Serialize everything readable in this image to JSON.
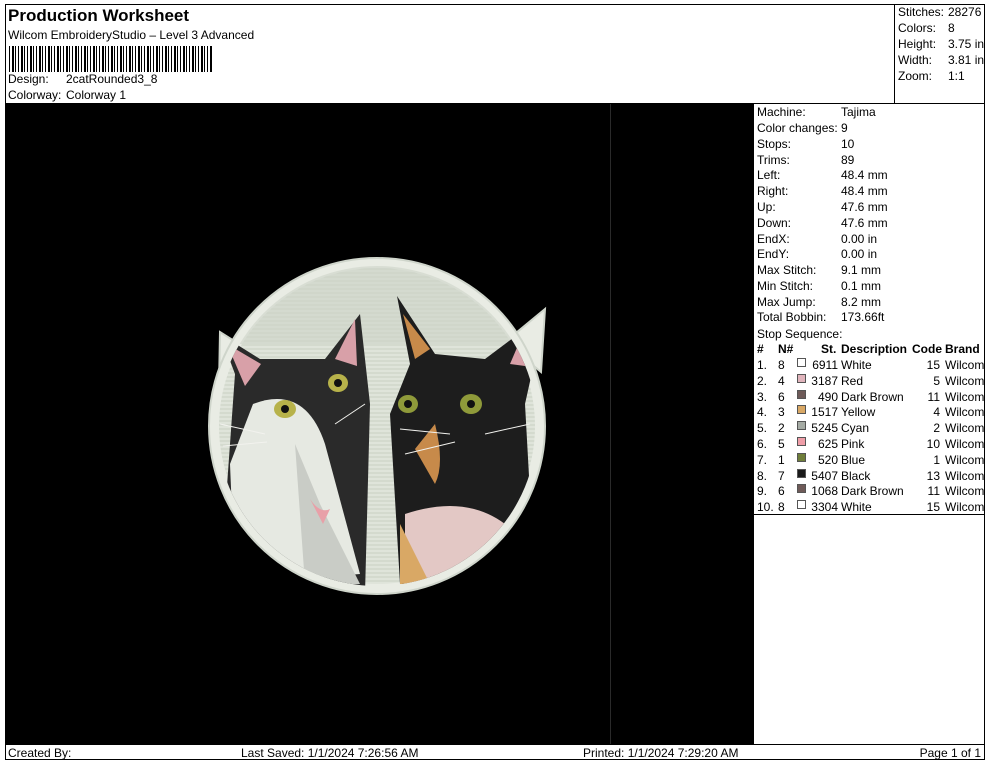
{
  "header": {
    "title": "Production Worksheet",
    "subtitle": "Wilcom EmbroideryStudio – Level 3 Advanced",
    "design_label": "Design:",
    "design_value": "2catRounded3_8",
    "colorway_label": "Colorway:",
    "colorway_value": "Colorway 1"
  },
  "summary": [
    {
      "label": "Stitches:",
      "value": "28276"
    },
    {
      "label": "Colors:",
      "value": "8"
    },
    {
      "label": "Height:",
      "value": "3.75 in"
    },
    {
      "label": "Width:",
      "value": "3.81 in"
    },
    {
      "label": "Zoom:",
      "value": "1:1"
    }
  ],
  "machine_info": [
    {
      "label": "Machine:",
      "value": "Tajima"
    },
    {
      "label": "Color changes:",
      "value": "9"
    },
    {
      "label": "Stops:",
      "value": "10"
    },
    {
      "label": "Trims:",
      "value": "89"
    },
    {
      "label": "Left:",
      "value": "48.4 mm"
    },
    {
      "label": "Right:",
      "value": "48.4 mm"
    },
    {
      "label": "Up:",
      "value": "47.6 mm"
    },
    {
      "label": "Down:",
      "value": "47.6 mm"
    },
    {
      "label": "EndX:",
      "value": "0.00 in"
    },
    {
      "label": "EndY:",
      "value": "0.00 in"
    },
    {
      "label": "Max Stitch:",
      "value": "9.1 mm"
    },
    {
      "label": "Min Stitch:",
      "value": "0.1 mm"
    },
    {
      "label": "Max Jump:",
      "value": "8.2 mm"
    },
    {
      "label": "Total Bobbin:",
      "value": "173.66ft"
    }
  ],
  "stop_sequence": {
    "title": "Stop Sequence:",
    "headers": {
      "num": "#",
      "needle": "N#",
      "st": "St.",
      "description": "Description",
      "code": "Code",
      "brand": "Brand"
    },
    "rows": [
      {
        "num": "1.",
        "needle": "8",
        "color": "#ffffff",
        "st": "6911",
        "description": "White",
        "code": "15",
        "brand": "Wilcom"
      },
      {
        "num": "2.",
        "needle": "4",
        "color": "#e0b4bc",
        "st": "3187",
        "description": "Red",
        "code": "5",
        "brand": "Wilcom"
      },
      {
        "num": "3.",
        "needle": "6",
        "color": "#6e5a58",
        "st": "490",
        "description": "Dark Brown",
        "code": "11",
        "brand": "Wilcom"
      },
      {
        "num": "4.",
        "needle": "3",
        "color": "#d9a865",
        "st": "1517",
        "description": "Yellow",
        "code": "4",
        "brand": "Wilcom"
      },
      {
        "num": "5.",
        "needle": "2",
        "color": "#a5aba4",
        "st": "5245",
        "description": "Cyan",
        "code": "2",
        "brand": "Wilcom"
      },
      {
        "num": "6.",
        "needle": "5",
        "color": "#ef9ea8",
        "st": "625",
        "description": "Pink",
        "code": "10",
        "brand": "Wilcom"
      },
      {
        "num": "7.",
        "needle": "1",
        "color": "#6f7e3a",
        "st": "520",
        "description": "Blue",
        "code": "1",
        "brand": "Wilcom"
      },
      {
        "num": "8.",
        "needle": "7",
        "color": "#1a1a1a",
        "st": "5407",
        "description": "Black",
        "code": "13",
        "brand": "Wilcom"
      },
      {
        "num": "9.",
        "needle": "6",
        "color": "#6e5a58",
        "st": "1068",
        "description": "Dark Brown",
        "code": "11",
        "brand": "Wilcom"
      },
      {
        "num": "10.",
        "needle": "8",
        "color": "#ffffff",
        "st": "3304",
        "description": "White",
        "code": "15",
        "brand": "Wilcom"
      }
    ]
  },
  "footer": {
    "created_by": "Created By:",
    "last_saved": "Last Saved: 1/1/2024 7:26:56 AM",
    "printed": "Printed: 1/1/2024 7:29:20 AM",
    "page": "Page 1 of 1"
  }
}
